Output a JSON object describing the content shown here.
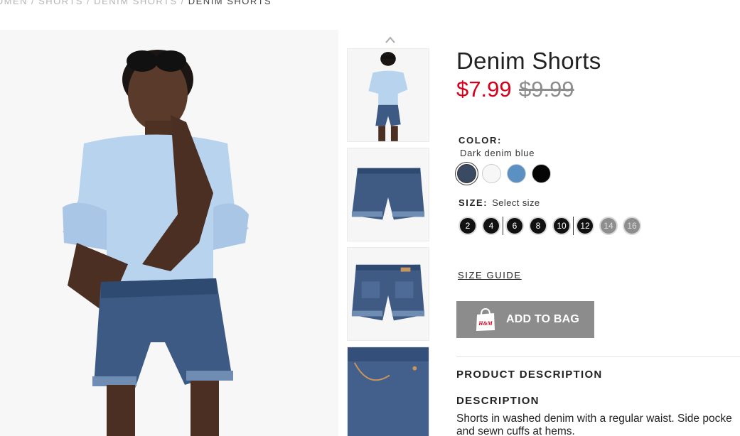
{
  "breadcrumb": {
    "items": [
      "OMEN",
      "SHORTS",
      "DENIM SHORTS"
    ],
    "separator": "/",
    "current": "DENIM SHORTS"
  },
  "product": {
    "title": "Denim Shorts",
    "price_sale": "$7.99",
    "price_original": "$9.99"
  },
  "color": {
    "label": "COLOR:",
    "selected_name": "Dark denim blue",
    "swatches": [
      {
        "name": "dark-denim-blue",
        "hex": "#3b4a63"
      },
      {
        "name": "white",
        "hex": "#f7f7f7"
      },
      {
        "name": "light-denim-blue",
        "hex": "#5b91c2"
      },
      {
        "name": "black",
        "hex": "#050505"
      }
    ]
  },
  "size": {
    "label": "SIZE:",
    "hint": "Select size",
    "options": [
      {
        "label": "2",
        "available": true
      },
      {
        "label": "4",
        "available": true
      },
      {
        "label": "6",
        "available": true
      },
      {
        "label": "8",
        "available": true
      },
      {
        "label": "10",
        "available": true
      },
      {
        "label": "12",
        "available": true
      },
      {
        "label": "14",
        "available": false
      },
      {
        "label": "16",
        "available": false
      }
    ]
  },
  "size_guide": "SIZE GUIDE",
  "add_to_bag": {
    "label": "ADD TO BAG",
    "icon": "shopping-bag-icon",
    "bag_text": "H&M",
    "color": "#8c8c8c"
  },
  "product_description_heading": "PRODUCT DESCRIPTION",
  "description": {
    "heading": "DESCRIPTION",
    "line1": "Shorts in washed denim with a regular waist. Side pocke",
    "line2": "and sewn cuffs at hems."
  },
  "colors": {
    "sale_price": "#d6001c",
    "old_price": "#8d8d8d"
  }
}
